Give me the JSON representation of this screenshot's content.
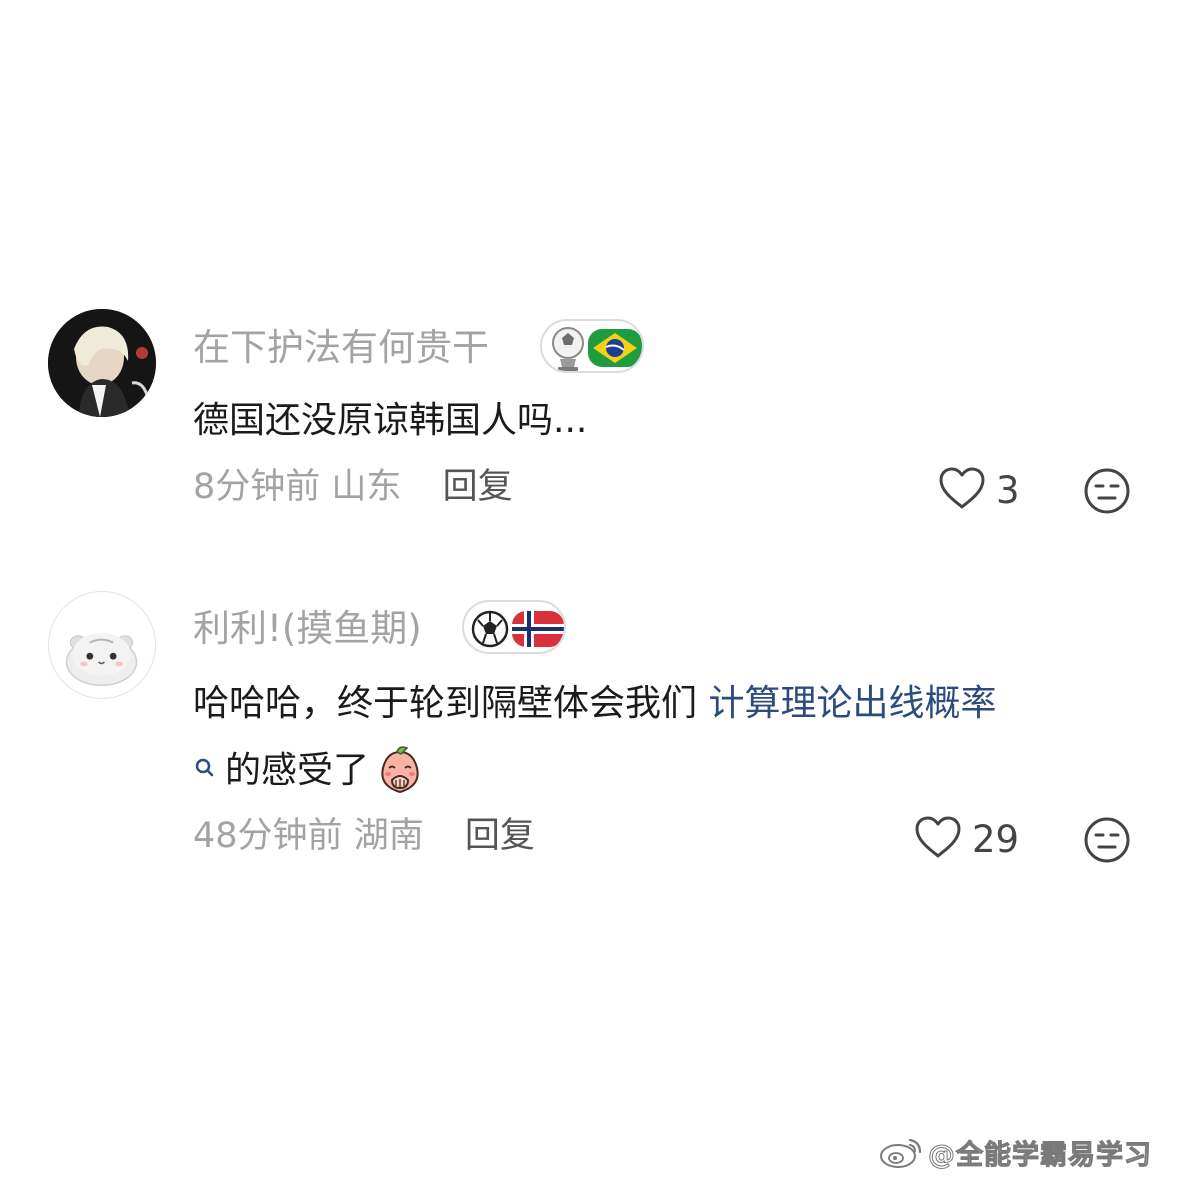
{
  "comments": [
    {
      "username": "在下护法有何贵干",
      "badge_icons": [
        "football-trophy-icon",
        "brazil-flag-icon"
      ],
      "text": "德国还没原谅韩国人吗...",
      "time": "8分钟前",
      "location": "山东",
      "reply_label": "回复",
      "like_count": "3"
    },
    {
      "username": "利利!(摸鱼期)",
      "badge_icons": [
        "football-icon",
        "norway-flag-icon"
      ],
      "text_line1_plain": "哈哈哈，终于轮到隔壁体会我们 ",
      "text_line1_link": "计算理论出线概率",
      "text_line2": "的感受了",
      "text_emoji": "peach-cover-mouth-emoji",
      "time": "48分钟前",
      "location": "湖南",
      "reply_label": "回复",
      "like_count": "29"
    }
  ],
  "watermark": {
    "text": "@全能学霸易学习",
    "icon": "weibo-logo-icon"
  },
  "colors": {
    "link": "#2d4b7c",
    "meta": "#a3a3a3",
    "text": "#1b1b1b"
  }
}
